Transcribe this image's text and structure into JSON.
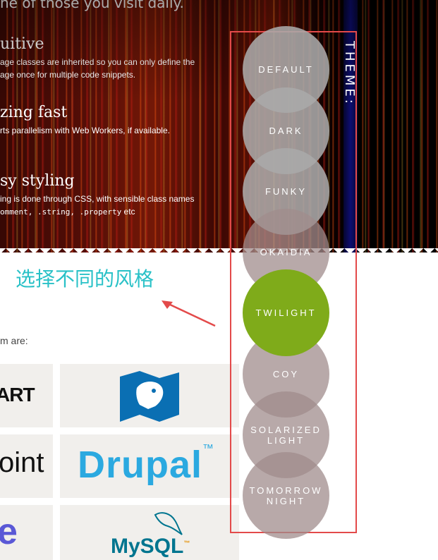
{
  "hero": {
    "top_line": "he of those you visit daily.",
    "features": [
      {
        "title": "uitive",
        "lines": [
          "age classes are inherited so you can only define the",
          "age once for multiple code snippets."
        ]
      },
      {
        "title": "zing fast",
        "lines": [
          "rts parallelism with Web Workers, if available."
        ]
      },
      {
        "title": "sy styling",
        "lines": [
          "ing is done through CSS, with sensible class names"
        ],
        "code": "omment, .string, .property",
        "code_suffix": " etc"
      }
    ]
  },
  "annotation": {
    "text": "选择不同的风格",
    "color": "#29c1c7"
  },
  "users": {
    "label": "m are:",
    "logos": [
      {
        "name": "smashing-magazine",
        "text": "ART"
      },
      {
        "name": "drupal-lion",
        "text": ""
      },
      {
        "name": "sitepoint",
        "text": "oint"
      },
      {
        "name": "drupal",
        "text": "Drupal",
        "tm": "™"
      },
      {
        "name": "partial-e",
        "text": "e"
      },
      {
        "name": "mysql",
        "text": "MySQL",
        "tm": "™"
      }
    ]
  },
  "theme_selector": {
    "label": "THEME:",
    "options": [
      "DEFAULT",
      "DARK",
      "FUNKY",
      "OKAIDIA",
      "TWILIGHT",
      "COY",
      "SOLARIZED LIGHT",
      "TOMORROW NIGHT"
    ],
    "selected": "TWILIGHT",
    "accent": "#7fab1a",
    "outline_color": "#e34a4a"
  }
}
